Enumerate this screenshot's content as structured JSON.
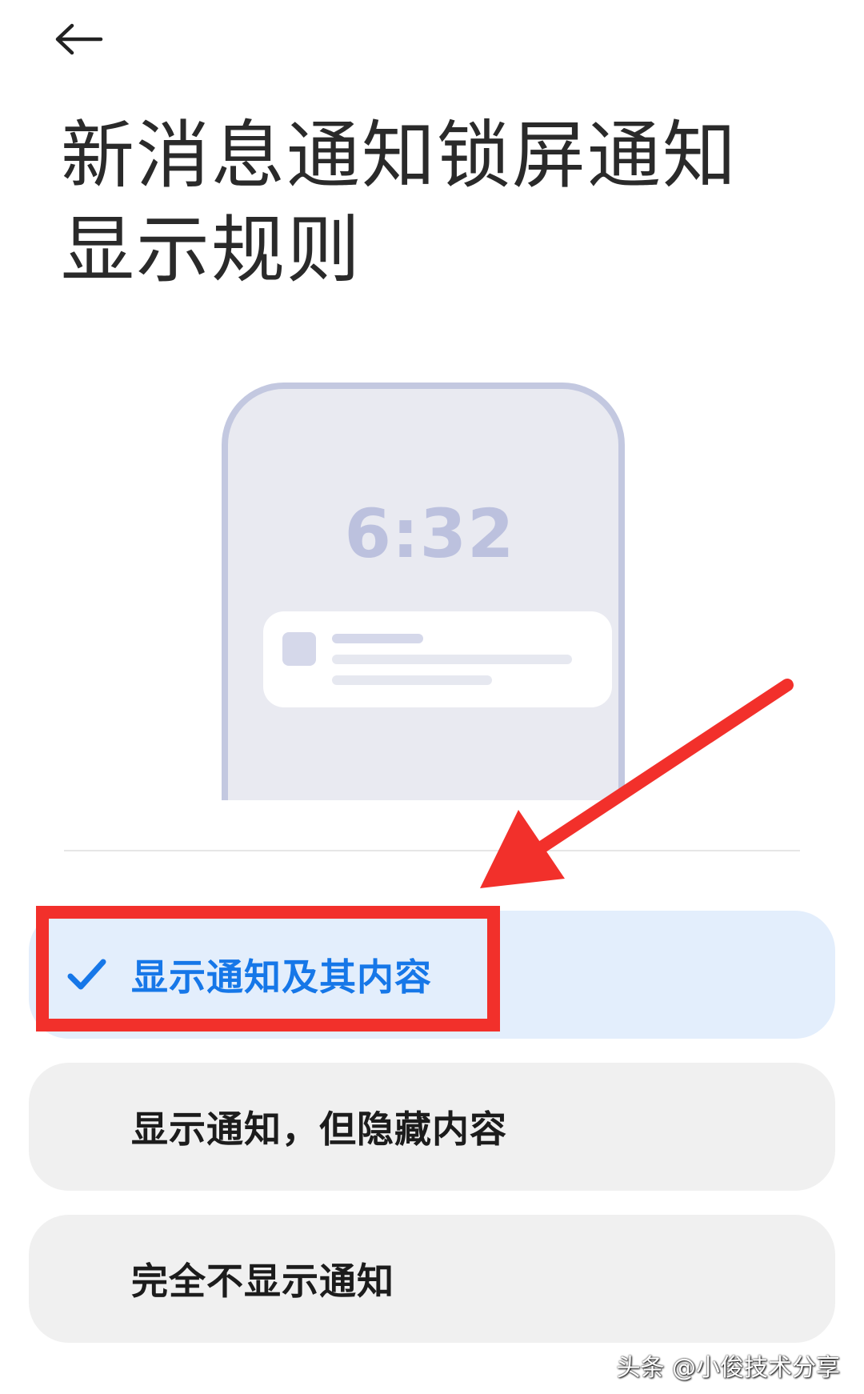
{
  "header": {
    "back_icon": "arrow-left-icon",
    "title": "新消息通知锁屏通知显示规则"
  },
  "illustration": {
    "lock_time": "6:32",
    "frame_color": "#c3c8e0",
    "screen_color": "#e9eaf1"
  },
  "options": [
    {
      "label": "显示通知及其内容",
      "selected": true
    },
    {
      "label": "显示通知，但隐藏内容",
      "selected": false
    },
    {
      "label": "完全不显示通知",
      "selected": false
    }
  ],
  "colors": {
    "accent": "#1677e8",
    "selected_bg": "#e3eefc",
    "option_bg": "#f0f0f0",
    "annotation": "#f2302b"
  },
  "watermark": "头条 @小俊技术分享"
}
